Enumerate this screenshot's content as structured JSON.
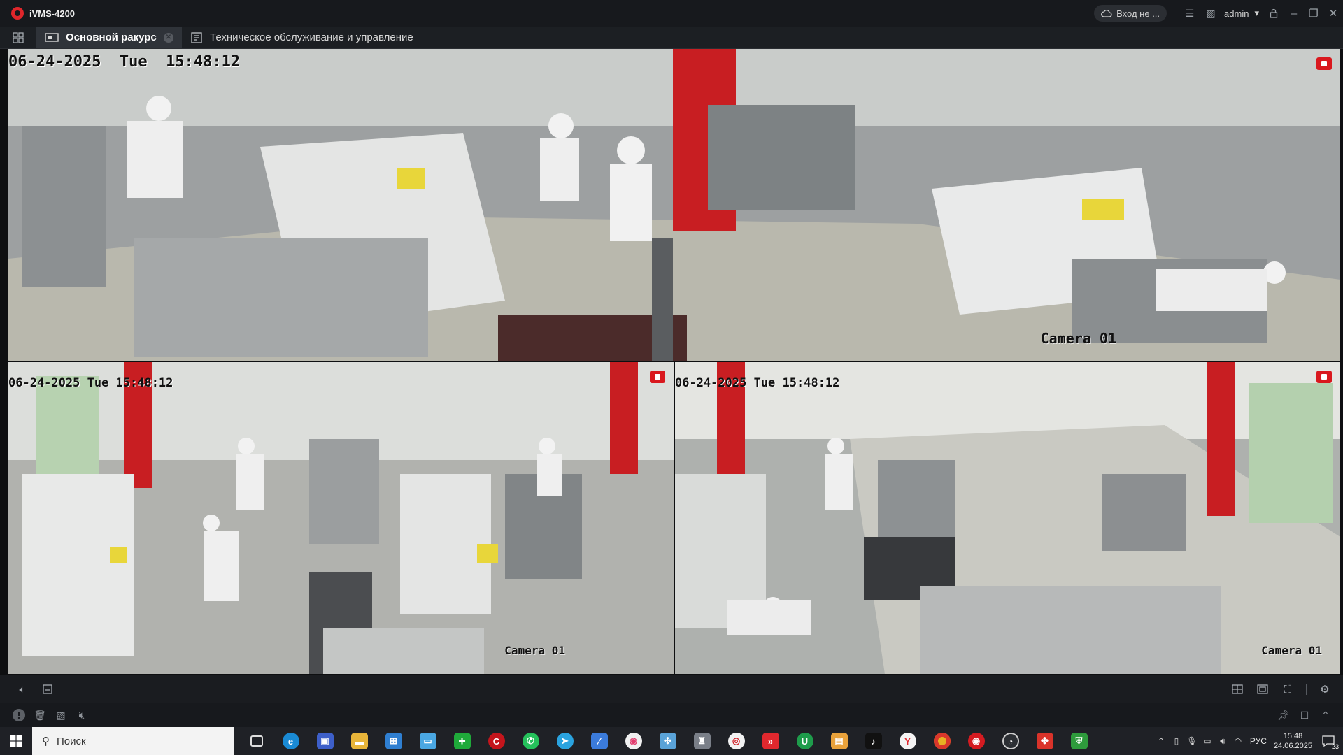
{
  "app": {
    "title": "iVMS-4200"
  },
  "titlebar": {
    "cloud_label": "Вход не ...",
    "user": "admin"
  },
  "tabs": [
    {
      "label": "Основной ракурс",
      "active": true
    },
    {
      "label": "Техническое обслуживание и управление",
      "active": false
    }
  ],
  "panes": [
    {
      "timestamp": "06-24-2025  Tue  15:48:12",
      "camera": "Camera 01",
      "recording": true
    },
    {
      "timestamp": "06-24-2025 Tue 15:48:12",
      "camera": "Camera 01",
      "recording": true
    },
    {
      "timestamp": "06-24-2025 Tue 15:48:12",
      "camera": "Camera 01",
      "recording": true
    }
  ],
  "taskbar": {
    "search_placeholder": "Поиск",
    "language": "РУС",
    "time": "15:48",
    "date": "24.06.2025",
    "notification_count": "23"
  },
  "colors": {
    "accent": "#d9181e",
    "titlebar": "#17191d",
    "tab_active": "#2f3339"
  }
}
